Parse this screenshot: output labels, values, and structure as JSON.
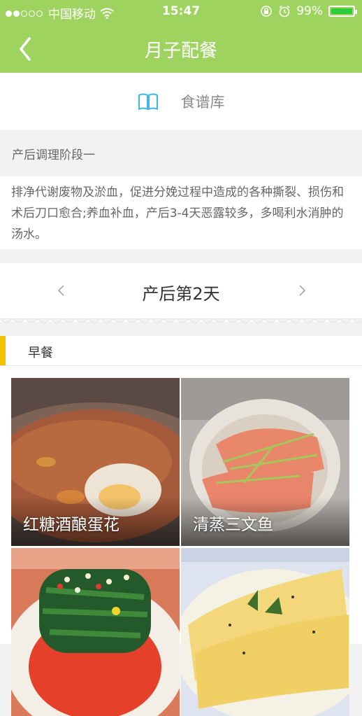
{
  "status_bar": {
    "carrier": "中国移动",
    "time": "15:47",
    "battery_text": "99%",
    "battery_level": 0.99
  },
  "nav": {
    "title": "月子配餐"
  },
  "tab": {
    "label": "食谱库"
  },
  "stage": {
    "title": "产后调理阶段一",
    "description": "排净代谢废物及淤血，促进分娩过程中造成的各种撕裂、损伤和术后刀口愈合;养血补血，产后3-4天恶露较多，多喝利水消肿的汤水。"
  },
  "day_selector": {
    "label": "产后第2天"
  },
  "meal": {
    "label": "早餐"
  },
  "recipes": [
    {
      "name": "红糖酒酿蛋花"
    },
    {
      "name": "清蒸三文鱼"
    },
    {
      "name": ""
    },
    {
      "name": ""
    }
  ],
  "colors": {
    "brand": "#9ed35f",
    "accent_bar": "#f2c200",
    "book_icon": "#3fb7e3"
  }
}
